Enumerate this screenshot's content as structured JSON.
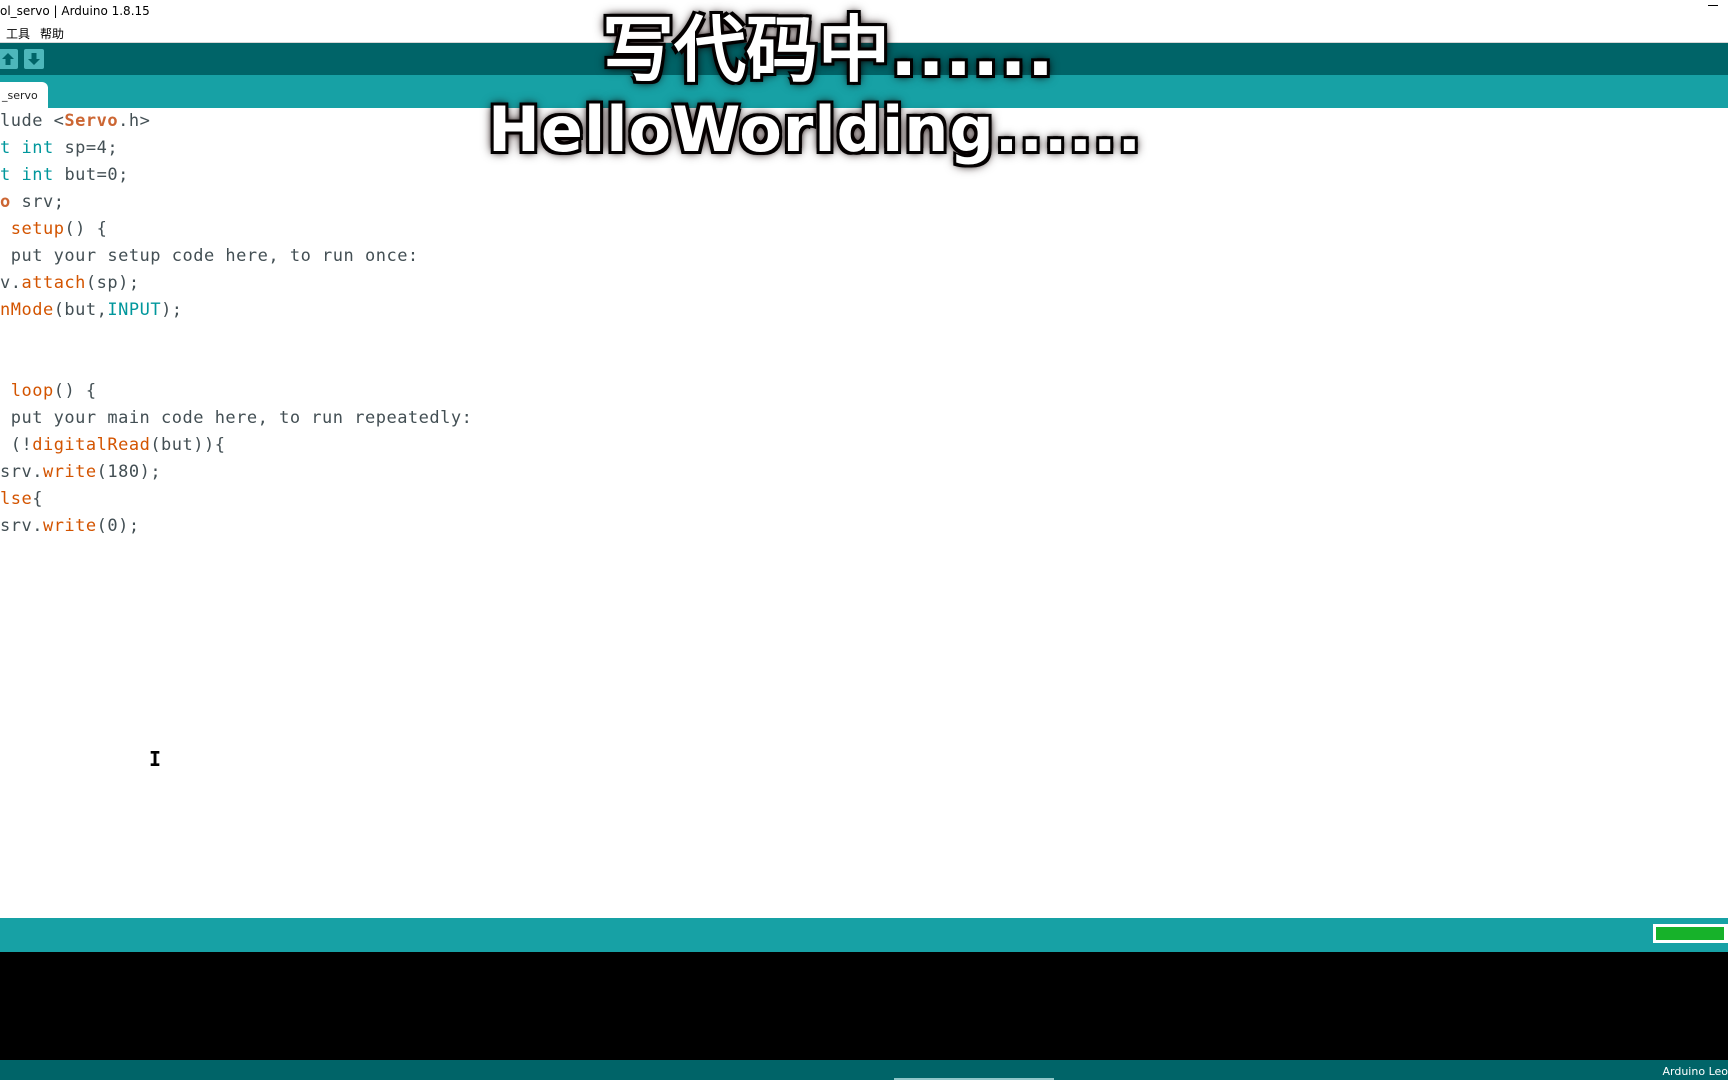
{
  "window": {
    "title": "ol_servo | Arduino 1.8.15"
  },
  "menu": {
    "items": [
      "工具",
      "帮助"
    ]
  },
  "toolbar": {
    "upload_icon": "arrow-up-icon",
    "download_icon": "arrow-down-icon"
  },
  "tabs": [
    {
      "label": "_servo"
    }
  ],
  "editor": {
    "lines": [
      {
        "segments": [
          {
            "t": "lude <",
            "c": ""
          },
          {
            "t": "Servo",
            "c": "typ"
          },
          {
            "t": ".h>",
            "c": ""
          }
        ]
      },
      {
        "segments": [
          {
            "t": "t ",
            "c": "kw"
          },
          {
            "t": "int",
            "c": "kw"
          },
          {
            "t": " sp=4;",
            "c": ""
          }
        ]
      },
      {
        "segments": [
          {
            "t": "t ",
            "c": "kw"
          },
          {
            "t": "int",
            "c": "kw"
          },
          {
            "t": " but=0;",
            "c": ""
          }
        ]
      },
      {
        "segments": [
          {
            "t": "o",
            "c": "typ"
          },
          {
            "t": " srv;",
            "c": ""
          }
        ]
      },
      {
        "segments": [
          {
            "t": " ",
            "c": ""
          },
          {
            "t": "setup",
            "c": "fn"
          },
          {
            "t": "() {",
            "c": ""
          }
        ]
      },
      {
        "segments": [
          {
            "t": " put your setup code here, to run once:",
            "c": "cm"
          }
        ]
      },
      {
        "segments": [
          {
            "t": "v.",
            "c": ""
          },
          {
            "t": "attach",
            "c": "fn"
          },
          {
            "t": "(sp);",
            "c": ""
          }
        ]
      },
      {
        "segments": [
          {
            "t": "nMode",
            "c": "fn"
          },
          {
            "t": "(but,",
            "c": ""
          },
          {
            "t": "INPUT",
            "c": "kw"
          },
          {
            "t": ");",
            "c": ""
          }
        ]
      },
      {
        "segments": []
      },
      {
        "segments": []
      },
      {
        "segments": [
          {
            "t": " ",
            "c": ""
          },
          {
            "t": "loop",
            "c": "fn"
          },
          {
            "t": "() {",
            "c": ""
          }
        ]
      },
      {
        "segments": [
          {
            "t": " put your main code here, to run repeatedly:",
            "c": "cm"
          }
        ]
      },
      {
        "segments": [
          {
            "t": " (!",
            "c": ""
          },
          {
            "t": "digitalRead",
            "c": "fn"
          },
          {
            "t": "(but)){",
            "c": ""
          }
        ]
      },
      {
        "segments": [
          {
            "t": "srv.",
            "c": ""
          },
          {
            "t": "write",
            "c": "fn"
          },
          {
            "t": "(180);",
            "c": ""
          }
        ]
      },
      {
        "segments": [
          {
            "t": "lse",
            "c": "fn"
          },
          {
            "t": "{",
            "c": ""
          }
        ]
      },
      {
        "segments": [
          {
            "t": "srv.",
            "c": ""
          },
          {
            "t": "write",
            "c": "fn"
          },
          {
            "t": "(0);",
            "c": ""
          }
        ]
      }
    ]
  },
  "overlay": {
    "line1": "写代码中......",
    "line2": "HelloWorlding......"
  },
  "progress": {
    "fraction": 0.95,
    "color": "#17b22a"
  },
  "statusbar": {
    "board": "Arduino Leo"
  },
  "colors": {
    "toolbar": "#006468",
    "tabbar": "#17a1a5",
    "keyword": "#00979c",
    "function": "#d35400"
  }
}
